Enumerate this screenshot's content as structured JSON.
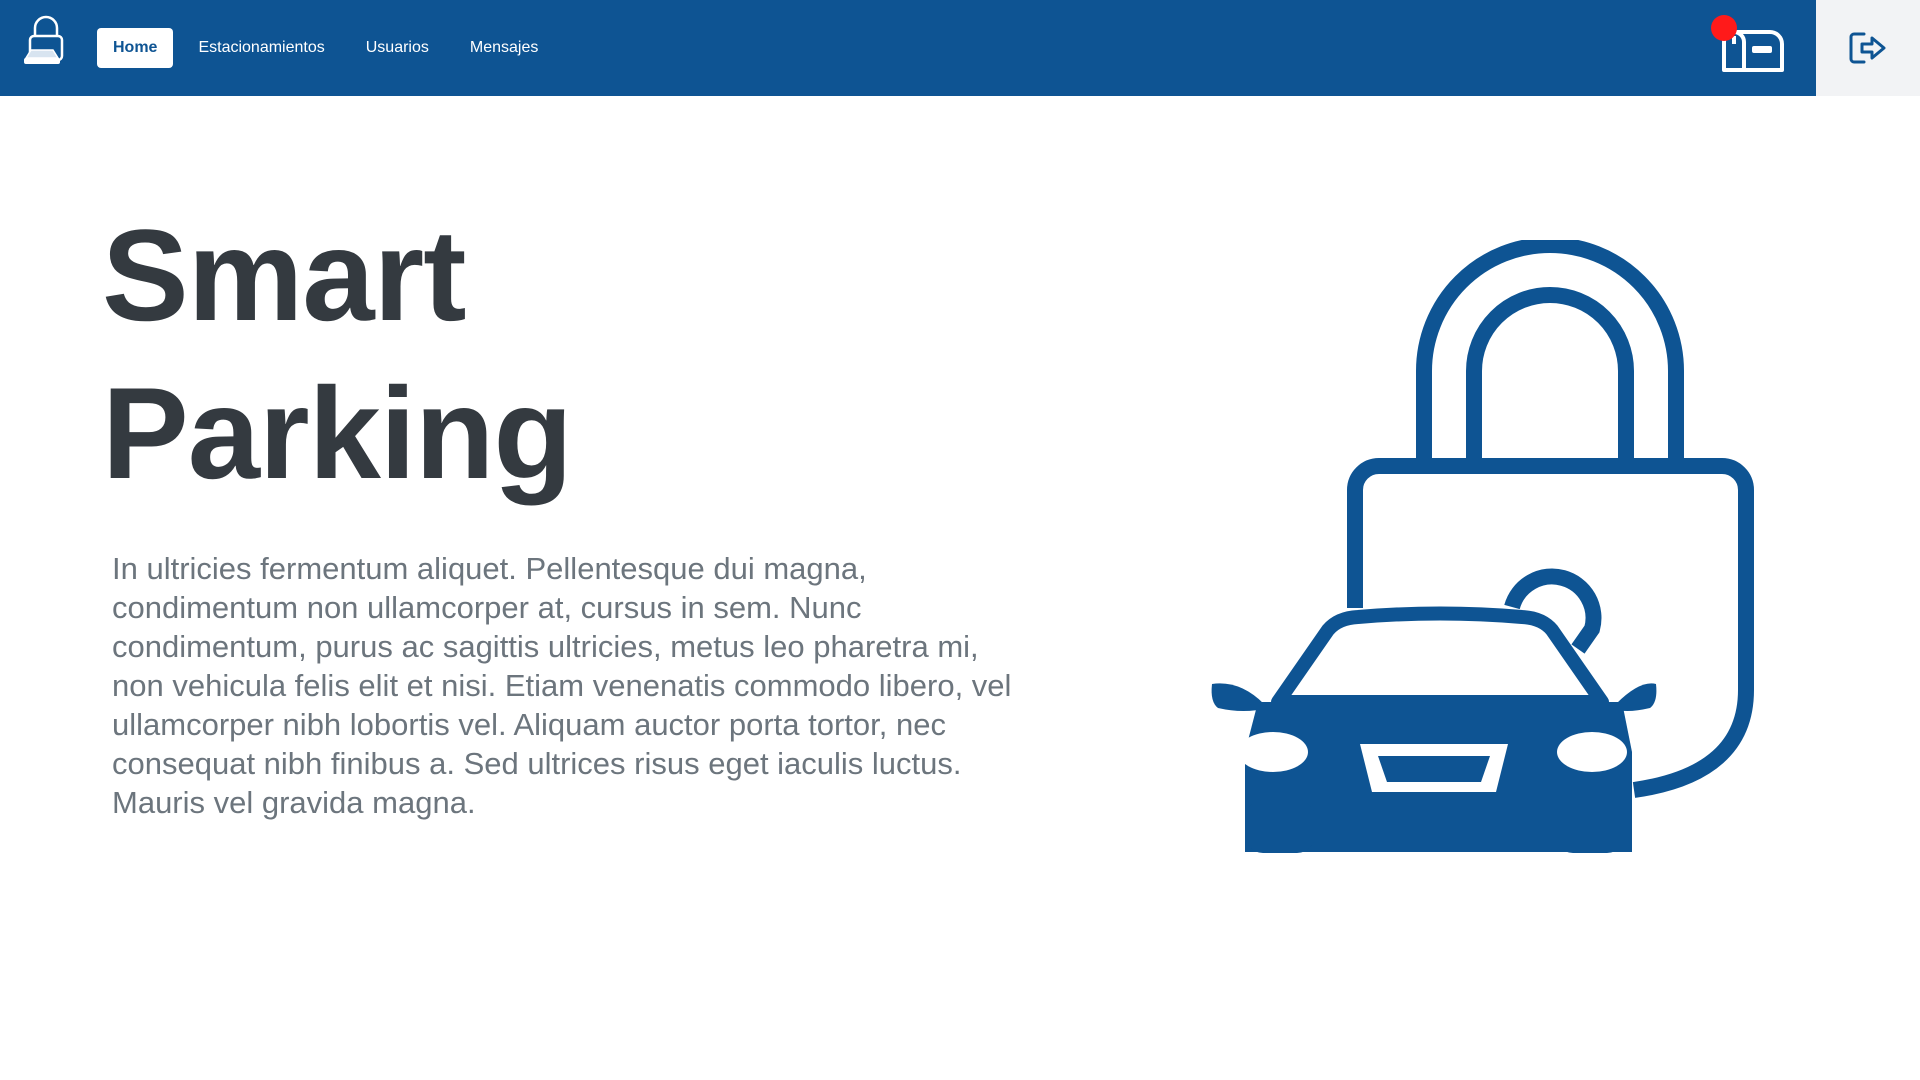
{
  "navbar": {
    "logo_icon": "padlock-car-logo-icon",
    "items": [
      {
        "label": "Home",
        "active": true
      },
      {
        "label": "Estacionamientos",
        "active": false
      },
      {
        "label": "Usuarios",
        "active": false
      },
      {
        "label": "Mensajes",
        "active": false
      }
    ],
    "mailbox_icon": "mailbox-icon",
    "notification_dot": true,
    "logout_icon": "logout-icon"
  },
  "hero": {
    "title": "Smart Parking",
    "text": "In ultricies fermentum aliquet. Pellentesque dui magna, condimentum non ullamcorper at, cursus in sem. Nunc condimentum, purus ac sagittis ultricies, metus leo pharetra mi, non vehicula felis elit et nisi. Etiam venenatis commodo libero, vel ullamcorper nibh lobortis vel. Aliquam auctor porta tortor, nec consequat nibh finibus a. Sed ultrices risus eget iaculis luctus. Mauris vel gravida magna.",
    "illustration_icon": "padlock-car-icon"
  },
  "colors": {
    "brand": "#0e5493",
    "notification": "#ff1a1a",
    "title": "#343a40",
    "body_text": "#6c757d"
  }
}
